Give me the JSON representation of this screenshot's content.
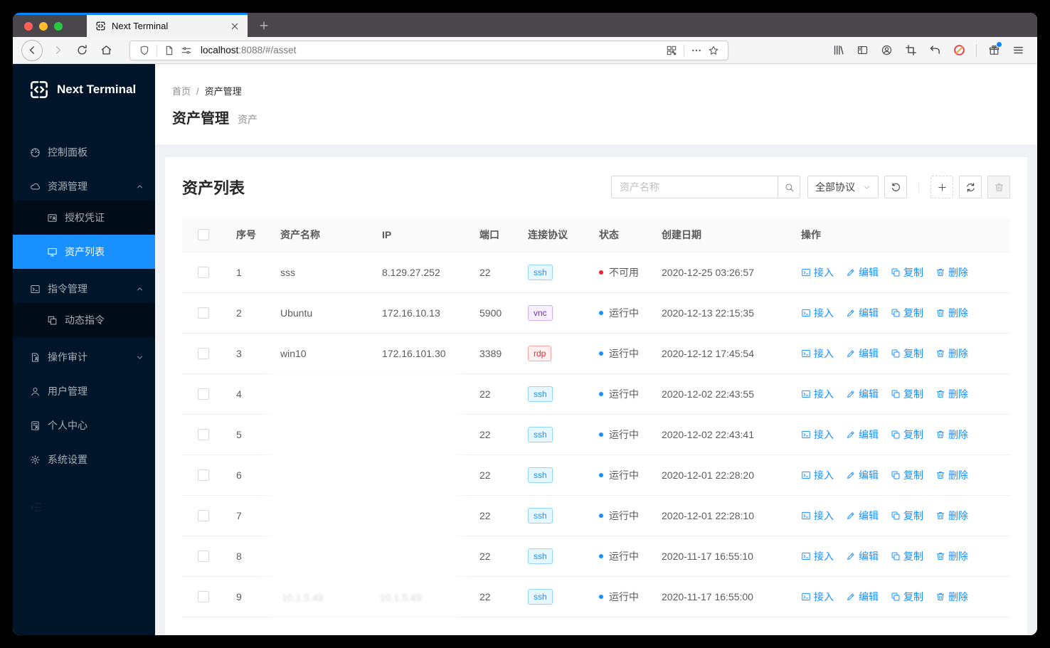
{
  "browser": {
    "tab_title": "Next Terminal",
    "url_host": "localhost",
    "url_rest": ":8088/#/asset"
  },
  "sidebar": {
    "logo_text": "Next Terminal",
    "items": [
      {
        "key": "dashboard",
        "label": "控制面板",
        "icon": "dashboard-icon",
        "level": 1
      },
      {
        "key": "resources",
        "label": "资源管理",
        "icon": "cloud-icon",
        "level": 1,
        "arrow": "up"
      },
      {
        "key": "credentials",
        "label": "授权凭证",
        "icon": "idcard-icon",
        "level": 2
      },
      {
        "key": "assets",
        "label": "资产列表",
        "icon": "desktop-icon",
        "level": 2,
        "active": true
      },
      {
        "key": "commands",
        "label": "指令管理",
        "icon": "code-icon",
        "level": 1,
        "arrow": "up"
      },
      {
        "key": "dynamic-commands",
        "label": "动态指令",
        "icon": "block-icon",
        "level": 2
      },
      {
        "key": "audit",
        "label": "操作审计",
        "icon": "audit-icon",
        "level": 1,
        "arrow": "down"
      },
      {
        "key": "users",
        "label": "用户管理",
        "icon": "user-icon",
        "level": 1
      },
      {
        "key": "profile",
        "label": "个人中心",
        "icon": "profile-icon",
        "level": 1
      },
      {
        "key": "settings",
        "label": "系统设置",
        "icon": "gear-icon",
        "level": 1
      }
    ]
  },
  "breadcrumb": {
    "home": "首页",
    "separator": "/",
    "current": "资产管理"
  },
  "page_header": {
    "title": "资产管理",
    "subtitle": "资产"
  },
  "asset_card": {
    "title": "资产列表",
    "search_placeholder": "资产名称",
    "protocol_select": "全部协议"
  },
  "table": {
    "headers": [
      "序号",
      "资产名称",
      "IP",
      "端口",
      "连接协议",
      "状态",
      "创建日期",
      "操作"
    ],
    "action_labels": [
      {
        "key": "connect",
        "label": "接入",
        "icon": "connect-icon"
      },
      {
        "key": "edit",
        "label": "编辑",
        "icon": "edit-icon"
      },
      {
        "key": "copy",
        "label": "复制",
        "icon": "copy-icon"
      },
      {
        "key": "delete",
        "label": "删除",
        "icon": "delete-icon"
      }
    ],
    "rows": [
      {
        "no": "1",
        "name": "sss",
        "ip": "8.129.27.252",
        "port": "22",
        "protocol": "ssh",
        "status": "不可用",
        "status_type": "error",
        "created": "2020-12-25 03:26:57",
        "blurred": false
      },
      {
        "no": "2",
        "name": "Ubuntu",
        "ip": "172.16.10.13",
        "port": "5900",
        "protocol": "vnc",
        "status": "运行中",
        "status_type": "processing",
        "created": "2020-12-13 22:15:35",
        "blurred": false
      },
      {
        "no": "3",
        "name": "win10",
        "ip": "172.16.101.30",
        "port": "3389",
        "protocol": "rdp",
        "status": "运行中",
        "status_type": "processing",
        "created": "2020-12-12 17:45:54",
        "blurred": false
      },
      {
        "no": "4",
        "name": "",
        "ip": "",
        "port": "22",
        "protocol": "ssh",
        "status": "运行中",
        "status_type": "processing",
        "created": "2020-12-02 22:43:55",
        "blurred": true
      },
      {
        "no": "5",
        "name": "",
        "ip": "",
        "port": "22",
        "protocol": "ssh",
        "status": "运行中",
        "status_type": "processing",
        "created": "2020-12-02 22:43:41",
        "blurred": true
      },
      {
        "no": "6",
        "name": "",
        "ip": "",
        "port": "22",
        "protocol": "ssh",
        "status": "运行中",
        "status_type": "processing",
        "created": "2020-12-01 22:28:20",
        "blurred": true
      },
      {
        "no": "7",
        "name": "",
        "ip": "",
        "port": "22",
        "protocol": "ssh",
        "status": "运行中",
        "status_type": "processing",
        "created": "2020-12-01 22:28:10",
        "blurred": true
      },
      {
        "no": "8",
        "name": "",
        "ip": "",
        "port": "22",
        "protocol": "ssh",
        "status": "运行中",
        "status_type": "processing",
        "created": "2020-11-17 16:55:10",
        "blurred": true
      },
      {
        "no": "9",
        "name": "10.1.5.49",
        "ip": "10.1.5.49",
        "port": "22",
        "protocol": "ssh",
        "status": "运行中",
        "status_type": "processing",
        "created": "2020-11-17 16:55:00",
        "blurred": true
      }
    ]
  },
  "colors": {
    "accent": "#1890ff",
    "sidebar_bg": "#001529",
    "submenu_bg": "#000c17",
    "status_error": "#f5222d",
    "status_processing": "#1890ff",
    "tab_line": "#0a84ff",
    "tag_ssh": "#1890ff",
    "tag_vnc": "#722ed1",
    "tag_rdp": "#f5222d"
  }
}
